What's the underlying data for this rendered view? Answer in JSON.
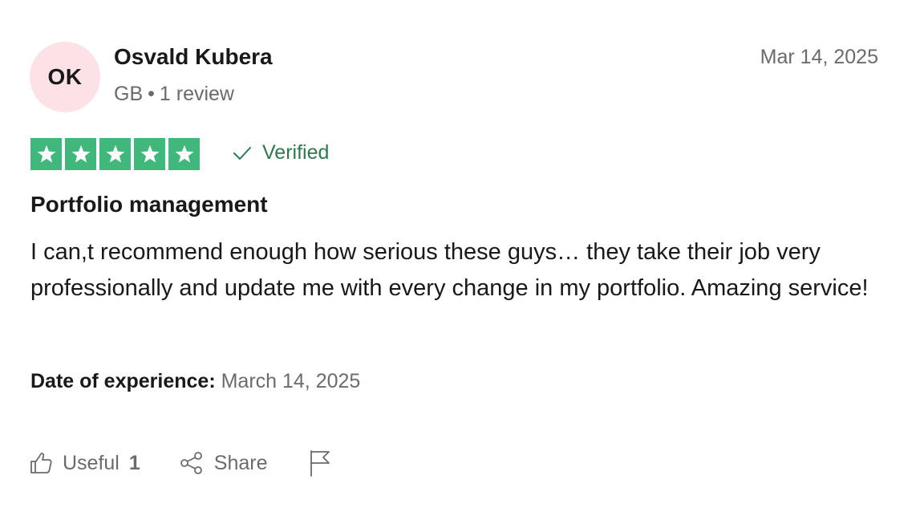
{
  "review": {
    "avatar_initials": "OK",
    "avatar_color": "#fce1e6",
    "reviewer_name": "Osvald Kubera",
    "country": "GB",
    "separator": "•",
    "review_count": "1 review",
    "date": "Mar 14, 2025",
    "rating": 5,
    "star_color": "#40b87c",
    "verified_label": "Verified",
    "title": "Portfolio management",
    "body": "I can,t recommend enough how serious these guys… they take their job very professionally and update me with every change in my portfolio. Amazing service!",
    "experience_label": "Date of experience:",
    "experience_date": "March 14, 2025"
  },
  "actions": {
    "useful_label": "Useful",
    "useful_count": "1",
    "share_label": "Share",
    "icons": [
      "thumbs-up-icon",
      "share-icon",
      "flag-icon"
    ]
  }
}
